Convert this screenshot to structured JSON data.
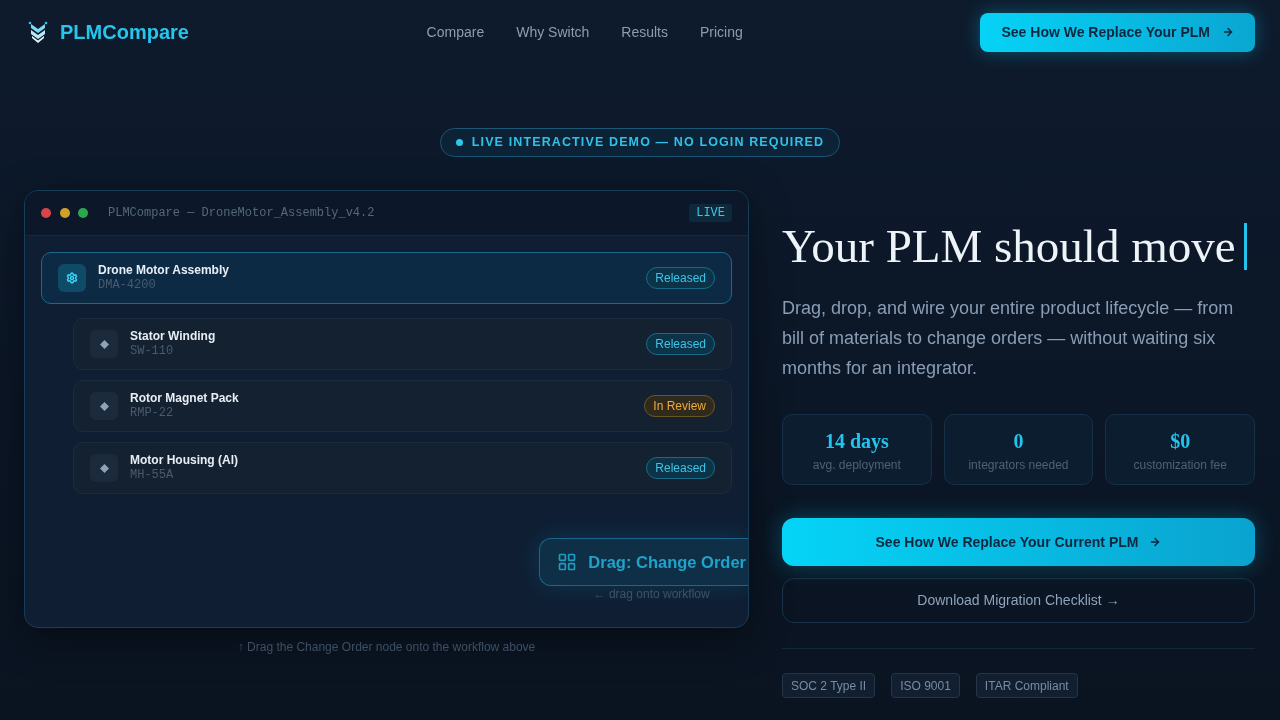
{
  "header": {
    "brand": "PLMCompare",
    "nav": [
      "Compare",
      "Why Switch",
      "Results",
      "Pricing"
    ],
    "cta": "See How We Replace Your PLM"
  },
  "badge": "LIVE INTERACTIVE DEMO — NO LOGIN REQUIRED",
  "demo_window": {
    "title": "PLMCompare — DroneMotor_Assembly_v4.2",
    "status_tag": "LIVE",
    "tree": [
      {
        "name": "Drone Motor Assembly",
        "code": "DMA-4200",
        "kind": "assembly",
        "selected": true,
        "status": {
          "label": "Released",
          "kind": "released"
        },
        "children": [
          {
            "name": "Stator Winding",
            "code": "SW-110",
            "kind": "part",
            "selected": false,
            "status": {
              "label": "Released",
              "kind": "released"
            }
          },
          {
            "name": "Rotor Magnet Pack",
            "code": "RMP-22",
            "kind": "part",
            "selected": false,
            "status": {
              "label": "In Review",
              "kind": "review"
            }
          },
          {
            "name": "Motor Housing (Al)",
            "code": "MH-55A",
            "kind": "part",
            "selected": false,
            "status": {
              "label": "Released",
              "kind": "released"
            }
          }
        ]
      }
    ],
    "drag_node": {
      "label": "Drag: Change Order",
      "hint": "← drag onto workflow"
    }
  },
  "demo_caption": "↑ Drag the Change Order node onto the workflow above",
  "hero": {
    "heading": "Your PLM should move",
    "text": "Drag, drop, and wire your entire product lifecycle — from bill of materials to change orders — without waiting six months for an integrator.",
    "stats": [
      {
        "value": "14 days",
        "label": "avg. deployment"
      },
      {
        "value": "0",
        "label": "integrators needed"
      },
      {
        "value": "$0",
        "label": "customization fee"
      }
    ],
    "primary_button": "See How We Replace Your Current PLM",
    "secondary_button": "Download Migration Checklist →",
    "compliance": [
      "SOC 2 Type II",
      "ISO 9001",
      "ITAR Compliant"
    ]
  }
}
